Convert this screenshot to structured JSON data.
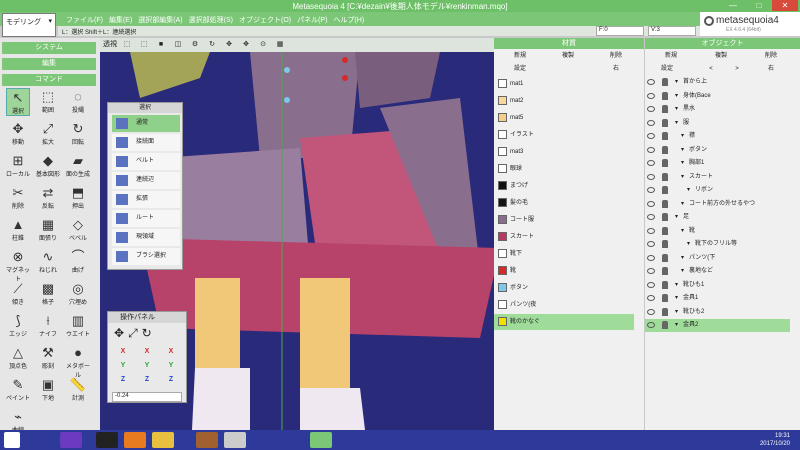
{
  "window": {
    "title": "Metasequoia 4 [C:¥dezain¥後期人体モデル¥renkinman.mqo]",
    "min": "—",
    "max": "□",
    "close": "✕"
  },
  "mode": {
    "value": "モデリング",
    "arrow": "▾"
  },
  "menus": [
    "ファイル(F)",
    "編集(E)",
    "選択部編集(A)",
    "選択部処理(S)",
    "オブジェクト(O)",
    "パネル(P)",
    "ヘルプ(H)"
  ],
  "status": {
    "hint": "L：選択 Shift＋L：連続選択",
    "f": "F:0",
    "v": "V:3"
  },
  "logo": {
    "name": "metasequoia4",
    "version": "EX 4.6.4 (64bit)"
  },
  "left": {
    "system": "システム",
    "edit": "編集",
    "command": "コマンド",
    "tools": [
      {
        "label": "選択",
        "icon": "↖"
      },
      {
        "label": "範囲",
        "icon": "⬚"
      },
      {
        "label": "投縄",
        "icon": "◌"
      },
      {
        "label": "移動",
        "icon": "✥"
      },
      {
        "label": "拡大",
        "icon": "⤢"
      },
      {
        "label": "回転",
        "icon": "↻"
      },
      {
        "label": "ローカル",
        "icon": "⊞"
      },
      {
        "label": "基本図形",
        "icon": "◆"
      },
      {
        "label": "面の生成",
        "icon": "▰"
      },
      {
        "label": "削除",
        "icon": "✂"
      },
      {
        "label": "反転",
        "icon": "⇄"
      },
      {
        "label": "押出",
        "icon": "⬒"
      },
      {
        "label": "柱錐",
        "icon": "▲"
      },
      {
        "label": "面張り",
        "icon": "▦"
      },
      {
        "label": "ベベル",
        "icon": "◇"
      },
      {
        "label": "マグネット",
        "icon": "⊗"
      },
      {
        "label": "ねじれ",
        "icon": "∿"
      },
      {
        "label": "曲げ",
        "icon": "⌒"
      },
      {
        "label": "傾き",
        "icon": "⟋"
      },
      {
        "label": "格子",
        "icon": "▩"
      },
      {
        "label": "穴埋め",
        "icon": "◎"
      },
      {
        "label": "エッジ",
        "icon": "⟆"
      },
      {
        "label": "ナイフ",
        "icon": "⟊"
      },
      {
        "label": "ウエイト",
        "icon": "▥"
      },
      {
        "label": "頂点色",
        "icon": "△"
      },
      {
        "label": "彫刻",
        "icon": "⚒"
      },
      {
        "label": "メタボール",
        "icon": "●"
      },
      {
        "label": "ペイント",
        "icon": "✎"
      },
      {
        "label": "下地",
        "icon": "▣"
      },
      {
        "label": "計測",
        "icon": "📏"
      },
      {
        "label": "曲線",
        "icon": "⌁"
      }
    ]
  },
  "viewport": {
    "toolbar": [
      "透視",
      "⬚",
      "⬚",
      "■",
      "◫",
      "⚙",
      "↻",
      "✥",
      "✥",
      "⊙",
      "▦"
    ]
  },
  "select_panel": {
    "title": "選択",
    "items": [
      "通常",
      "接続面",
      "ベルト",
      "連続辺",
      "拡張",
      "ルート",
      "現領域",
      "ブラシ選択"
    ]
  },
  "op_panel": {
    "title": "操作パネル",
    "axes": [
      "X",
      "X",
      "X",
      "Y",
      "Y",
      "Y",
      "Z",
      "Z",
      "Z"
    ],
    "value": "-0.24"
  },
  "materials": {
    "title": "材質",
    "buttons": [
      "新規",
      "複製",
      "削除"
    ],
    "setting": "設定",
    "shortcut": "右",
    "items": [
      {
        "name": "mat1",
        "color": "#ffffff"
      },
      {
        "name": "mat2",
        "color": "#f8d8a0"
      },
      {
        "name": "mat5",
        "color": "#f3cf8a"
      },
      {
        "name": "イラスト",
        "color": "#ffffff"
      },
      {
        "name": "mat3",
        "color": "#ffffff"
      },
      {
        "name": "眼球",
        "color": "#ffffff"
      },
      {
        "name": "まつげ",
        "color": "#111111"
      },
      {
        "name": "髪の毛",
        "color": "#151515"
      },
      {
        "name": "コート服",
        "color": "#8a6e8e"
      },
      {
        "name": "スカート",
        "color": "#b83a64"
      },
      {
        "name": "靴下",
        "color": "#ffffff"
      },
      {
        "name": "靴",
        "color": "#d42a2a"
      },
      {
        "name": "ボタン",
        "color": "#7ec8e8"
      },
      {
        "name": "パンツ(夜",
        "color": "#ffffff"
      },
      {
        "name": "靴のかなぐ",
        "color": "#f0e000"
      }
    ],
    "selected": 14
  },
  "objects": {
    "title": "オブジェクト",
    "buttons": [
      "新規",
      "複製",
      "削除"
    ],
    "setting": "設定",
    "nav": [
      "<",
      ">",
      "右"
    ],
    "items": [
      "首から上",
      "身体(Bace",
      "黒水",
      "服",
      "襟",
      "ボタン",
      "胸部1",
      "スカート",
      "リボン",
      "コート前方の外せるやつ",
      "足",
      "靴",
      "靴下のフリル等",
      "パンツ(下",
      "裏地など",
      "靴ひも1",
      "金具1",
      "靴ひも2",
      "金具2"
    ],
    "selected": 18
  },
  "taskbar": {
    "time": "19:31",
    "date": "2017/10/20"
  },
  "colors": {
    "accent": "#7cc777",
    "title": "#6dc067",
    "taskbar": "#2d3a9a",
    "selected": "#9fdc9a"
  }
}
